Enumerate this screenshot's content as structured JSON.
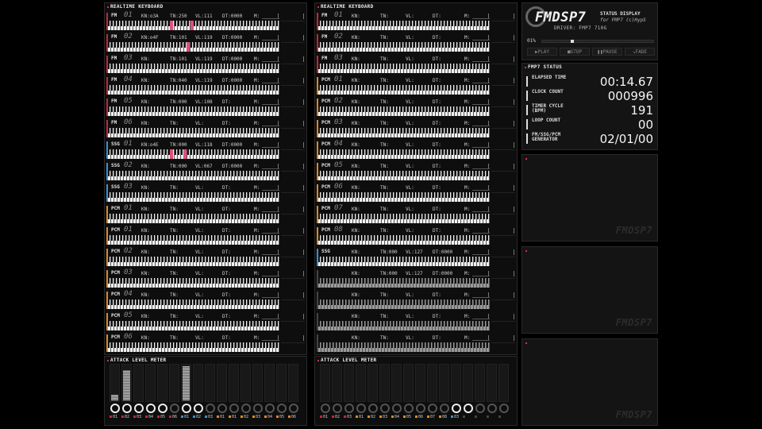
{
  "panels": {
    "left_keyboard_title": "REALTIME KEYBOARD",
    "right_keyboard_title": "REALTIME KEYBOARD",
    "left_meter_title": "ATTACK LEVEL METER",
    "right_meter_title": "ATTACK LEVEL METER",
    "status_title": "FMP7 STATUS"
  },
  "colors": {
    "fm": "#c0283a",
    "ssg": "#3a8fd0",
    "pcm": "#d88a28",
    "accent_red": "#d83040",
    "key_highlight": "#e0507a"
  },
  "left_channels": [
    {
      "type": "FM",
      "num": "01",
      "kn": "KN:o3A",
      "tn": "TN:250",
      "vl": "VL:111",
      "dt": "DT:0000",
      "m": "M:",
      "hl": [
        0.36,
        0.48
      ]
    },
    {
      "type": "FM",
      "num": "02",
      "kn": "KN:o4F",
      "tn": "TN:101",
      "vl": "VL:119",
      "dt": "DT:0000",
      "m": "M:",
      "hl": [
        0.46
      ]
    },
    {
      "type": "FM",
      "num": "03",
      "kn": "KN:",
      "tn": "TN:101",
      "vl": "VL:119",
      "dt": "DT:0000",
      "m": "M:",
      "hl": []
    },
    {
      "type": "FM",
      "num": "04",
      "kn": "KN:",
      "tn": "TN:040",
      "vl": "VL:119",
      "dt": "DT:0000",
      "m": "M:",
      "hl": []
    },
    {
      "type": "FM",
      "num": "05",
      "kn": "KN:",
      "tn": "TN:000",
      "vl": "VL:108",
      "dt": "DT:",
      "m": "M:",
      "hl": []
    },
    {
      "type": "FM",
      "num": "06",
      "kn": "KN:",
      "tn": "TN:",
      "vl": "VL:",
      "dt": "DT:",
      "m": "M:",
      "hl": []
    },
    {
      "type": "SSG",
      "num": "01",
      "kn": "KN:o4E",
      "tn": "TN:000",
      "vl": "VL:118",
      "dt": "DT:0000",
      "m": "M:",
      "hl": [
        0.36,
        0.44
      ]
    },
    {
      "type": "SSG",
      "num": "02",
      "kn": "KN:",
      "tn": "TN:000",
      "vl": "VL:067",
      "dt": "DT:0000",
      "m": "M:",
      "hl": []
    },
    {
      "type": "SSG",
      "num": "03",
      "kn": "KN:",
      "tn": "TN:",
      "vl": "VL:",
      "dt": "DT:",
      "m": "M:",
      "hl": []
    },
    {
      "type": "PCM",
      "num": "01",
      "kn": "KN:",
      "tn": "TN:",
      "vl": "VL:",
      "dt": "DT:",
      "m": "M:",
      "hl": []
    },
    {
      "type": "PCM",
      "num": "01",
      "kn": "KN:",
      "tn": "TN:",
      "vl": "VL:",
      "dt": "DT:",
      "m": "M:",
      "hl": []
    },
    {
      "type": "PCM",
      "num": "02",
      "kn": "KN:",
      "tn": "TN:",
      "vl": "VL:",
      "dt": "DT:",
      "m": "M:",
      "hl": []
    },
    {
      "type": "PCM",
      "num": "03",
      "kn": "KN:",
      "tn": "TN:",
      "vl": "VL:",
      "dt": "DT:",
      "m": "M:",
      "hl": []
    },
    {
      "type": "PCM",
      "num": "04",
      "kn": "KN:",
      "tn": "TN:",
      "vl": "VL:",
      "dt": "DT:",
      "m": "M:",
      "hl": []
    },
    {
      "type": "PCM",
      "num": "05",
      "kn": "KN:",
      "tn": "TN:",
      "vl": "VL:",
      "dt": "DT:",
      "m": "M:",
      "hl": []
    },
    {
      "type": "PCM",
      "num": "06",
      "kn": "KN:",
      "tn": "TN:",
      "vl": "VL:",
      "dt": "DT:",
      "m": "M:",
      "hl": []
    }
  ],
  "right_channels": [
    {
      "type": "FM",
      "num": "01",
      "kn": "KN:",
      "tn": "TN:",
      "vl": "VL:",
      "dt": "DT:",
      "m": "M:",
      "hl": []
    },
    {
      "type": "FM",
      "num": "02",
      "kn": "KN:",
      "tn": "TN:",
      "vl": "VL:",
      "dt": "DT:",
      "m": "M:",
      "hl": []
    },
    {
      "type": "FM",
      "num": "03",
      "kn": "KN:",
      "tn": "TN:",
      "vl": "VL:",
      "dt": "DT:",
      "m": "M:",
      "hl": []
    },
    {
      "type": "PCM",
      "num": "01",
      "kn": "KN:",
      "tn": "TN:",
      "vl": "VL:",
      "dt": "DT:",
      "m": "M:",
      "hl": []
    },
    {
      "type": "PCM",
      "num": "02",
      "kn": "KN:",
      "tn": "TN:",
      "vl": "VL:",
      "dt": "DT:",
      "m": "M:",
      "hl": []
    },
    {
      "type": "PCM",
      "num": "03",
      "kn": "KN:",
      "tn": "TN:",
      "vl": "VL:",
      "dt": "DT:",
      "m": "M:",
      "hl": []
    },
    {
      "type": "PCM",
      "num": "04",
      "kn": "KN:",
      "tn": "TN:",
      "vl": "VL:",
      "dt": "DT:",
      "m": "M:",
      "hl": []
    },
    {
      "type": "PCM",
      "num": "05",
      "kn": "KN:",
      "tn": "TN:",
      "vl": "VL:",
      "dt": "DT:",
      "m": "M:",
      "hl": []
    },
    {
      "type": "PCM",
      "num": "06",
      "kn": "KN:",
      "tn": "TN:",
      "vl": "VL:",
      "dt": "DT:",
      "m": "M:",
      "hl": []
    },
    {
      "type": "PCM",
      "num": "07",
      "kn": "KN:",
      "tn": "TN:",
      "vl": "VL:",
      "dt": "DT:",
      "m": "M:",
      "hl": []
    },
    {
      "type": "PCM",
      "num": "08",
      "kn": "KN:",
      "tn": "TN:",
      "vl": "VL:",
      "dt": "DT:",
      "m": "M:",
      "hl": []
    },
    {
      "type": "SSG",
      "num": "",
      "kn": "KN:",
      "tn": "TN:000",
      "vl": "VL:127",
      "dt": "DT:0000",
      "m": "M:",
      "hl": []
    },
    {
      "type": "",
      "num": "",
      "kn": "KN:",
      "tn": "TN:000",
      "vl": "VL:127",
      "dt": "DT:0000",
      "m": "M:",
      "hl": []
    },
    {
      "type": "",
      "num": "",
      "kn": "KN:",
      "tn": "TN:",
      "vl": "VL:",
      "dt": "DT:",
      "m": "M:",
      "hl": []
    },
    {
      "type": "",
      "num": "",
      "kn": "KN:",
      "tn": "TN:",
      "vl": "VL:",
      "dt": "DT:",
      "m": "M:",
      "hl": []
    },
    {
      "type": "",
      "num": "",
      "kn": "KN:",
      "tn": "TN:",
      "vl": "VL:",
      "dt": "DT:",
      "m": "M:",
      "hl": []
    }
  ],
  "left_meters": [
    {
      "label": "01",
      "type": "FM",
      "level": 0.15,
      "on": true
    },
    {
      "label": "02",
      "type": "FM",
      "level": 0.85,
      "on": true
    },
    {
      "label": "03",
      "type": "FM",
      "level": 0,
      "on": true
    },
    {
      "label": "04",
      "type": "FM",
      "level": 0,
      "on": true
    },
    {
      "label": "05",
      "type": "FM",
      "level": 0,
      "on": true
    },
    {
      "label": "06",
      "type": "FM",
      "level": 0,
      "on": false
    },
    {
      "label": "01",
      "type": "SSG",
      "level": 0.95,
      "on": true
    },
    {
      "label": "02",
      "type": "SSG",
      "level": 0,
      "on": true
    },
    {
      "label": "03",
      "type": "SSG",
      "level": 0,
      "on": false
    },
    {
      "label": "01",
      "type": "PCM",
      "level": 0,
      "on": false
    },
    {
      "label": "01",
      "type": "PCM",
      "level": 0,
      "on": false
    },
    {
      "label": "02",
      "type": "PCM",
      "level": 0,
      "on": false
    },
    {
      "label": "03",
      "type": "PCM",
      "level": 0,
      "on": false
    },
    {
      "label": "04",
      "type": "PCM",
      "level": 0,
      "on": false
    },
    {
      "label": "05",
      "type": "PCM",
      "level": 0,
      "on": false
    },
    {
      "label": "06",
      "type": "PCM",
      "level": 0,
      "on": false
    }
  ],
  "right_meters": [
    {
      "label": "01",
      "type": "FM",
      "level": 0,
      "on": false
    },
    {
      "label": "02",
      "type": "FM",
      "level": 0,
      "on": false
    },
    {
      "label": "03",
      "type": "FM",
      "level": 0,
      "on": false
    },
    {
      "label": "01",
      "type": "PCM",
      "level": 0,
      "on": false
    },
    {
      "label": "02",
      "type": "PCM",
      "level": 0,
      "on": false
    },
    {
      "label": "03",
      "type": "PCM",
      "level": 0,
      "on": false
    },
    {
      "label": "04",
      "type": "PCM",
      "level": 0,
      "on": false
    },
    {
      "label": "05",
      "type": "PCM",
      "level": 0,
      "on": false
    },
    {
      "label": "06",
      "type": "PCM",
      "level": 0,
      "on": false
    },
    {
      "label": "07",
      "type": "PCM",
      "level": 0,
      "on": false
    },
    {
      "label": "08",
      "type": "PCM",
      "level": 0,
      "on": false
    },
    {
      "label": "03",
      "type": "SSG",
      "level": 0,
      "on": true
    },
    {
      "label": "",
      "type": "",
      "level": 0,
      "on": true
    },
    {
      "label": "",
      "type": "",
      "level": 0,
      "on": false
    },
    {
      "label": "",
      "type": "",
      "level": 0,
      "on": false
    },
    {
      "label": "",
      "type": "",
      "level": 0,
      "on": false
    }
  ],
  "logo": {
    "title": "FMDSP7",
    "sub1": "STATUS DISPLAY",
    "sub2": "for FMP7 (c)HypS",
    "driver": "DRIVER: FMP7 710G",
    "progress_text": "01%",
    "progress": 0.26,
    "buttons": [
      "▶PLAY",
      "■STOP",
      "❚❚PAUSE",
      "↘FADE"
    ]
  },
  "status": [
    {
      "label": "ELAPSED TIME",
      "value": "00:14.67"
    },
    {
      "label": "CLOCK COUNT",
      "value": "000996"
    },
    {
      "label": "TIMER CYCLE (BPM)",
      "value": "191"
    },
    {
      "label": "LOOP COUNT",
      "value": "00"
    },
    {
      "label": "FM/SSG/PCM GENERATOR",
      "value": "02/01/00"
    }
  ],
  "watermark": "FMDSP7"
}
